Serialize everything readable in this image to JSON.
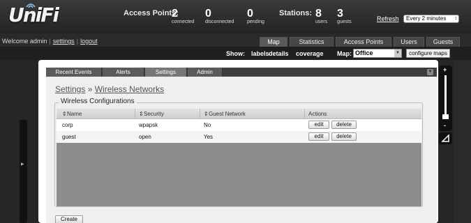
{
  "app": {
    "logo": "UniFi"
  },
  "stats": {
    "access_points_label": "Access Points:",
    "connected_value": "2",
    "connected_label": "connected",
    "disconnected_value": "0",
    "disconnected_label": "disconnected",
    "pending_value": "0",
    "pending_label": "pending",
    "stations_label": "Stations:",
    "users_value": "8",
    "users_label": "users",
    "guests_value": "3",
    "guests_label": "guests"
  },
  "refresh": {
    "label": "Refresh",
    "interval": "Every 2 minutes"
  },
  "welcome": {
    "text": "Welcome admin",
    "settings": "settings",
    "logout": "logout"
  },
  "nav": {
    "tabs": [
      "Map",
      "Statistics",
      "Access Points",
      "Users",
      "Guests"
    ],
    "active": "Map"
  },
  "toolbar": {
    "show_label": "Show:",
    "labels": "labels",
    "details": "details",
    "coverage": "coverage",
    "map_label": "Map:",
    "map_value": "Office",
    "configure_maps": "configure maps"
  },
  "panel": {
    "tabs": [
      "Recent Events",
      "Alerts",
      "Settings",
      "Admin"
    ],
    "active_tab": "Settings",
    "breadcrumb": {
      "settings": "Settings",
      "separator": "»",
      "section": "Wireless Networks"
    },
    "fieldset_title": "Wireless Configurations",
    "table": {
      "columns": [
        "Name",
        "Security",
        "Guest Network",
        "Actions"
      ],
      "rows": [
        {
          "name": "corp",
          "security": "wpapsk",
          "guest": "No",
          "edit": "edit",
          "delete": "delete"
        },
        {
          "name": "guest",
          "security": "open",
          "guest": "Yes",
          "edit": "edit",
          "delete": "delete"
        }
      ]
    },
    "create_button": "Create"
  },
  "zoom": {
    "plus": "+",
    "minus": "-"
  },
  "colors": {
    "topbar": "#2e2e2e",
    "panel_bg": "#efefef",
    "gray_area": "#8d8d8d"
  }
}
